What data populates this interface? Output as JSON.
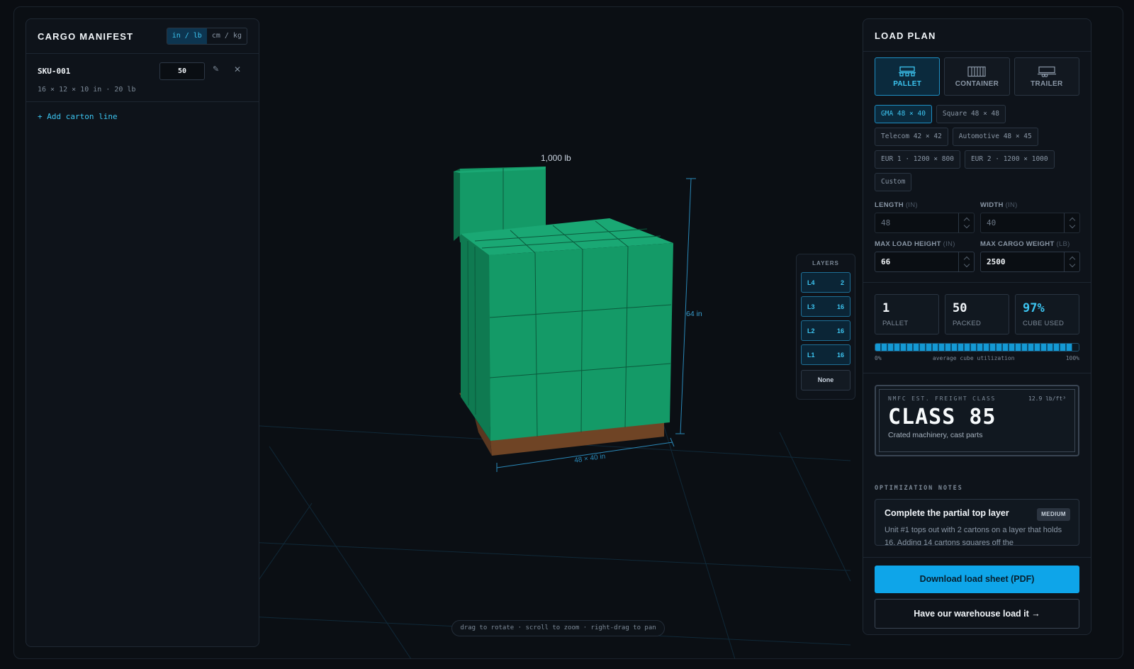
{
  "manifest": {
    "title": "CARGO MANIFEST",
    "units": [
      "in / lb",
      "cm / kg"
    ],
    "active_unit": "in / lb",
    "items": [
      {
        "sku": "SKU-001",
        "qty": "50",
        "dims": "16 × 12 × 10 in · 20 lb"
      }
    ],
    "add_line_label": "+ Add carton line"
  },
  "scene": {
    "weight_label": "1,000 lb",
    "height_label": "64 in",
    "footprint_label": "48 × 40 in",
    "carton_color": "#149a67",
    "pallet_color": "#7a4a26",
    "hint": "drag to rotate · scroll to zoom · right-drag to pan"
  },
  "layers": {
    "title": "LAYERS",
    "items": [
      {
        "id": "L4",
        "count": "2"
      },
      {
        "id": "L3",
        "count": "16"
      },
      {
        "id": "L2",
        "count": "16"
      },
      {
        "id": "L1",
        "count": "16"
      }
    ],
    "none_label": "None"
  },
  "load_plan": {
    "title": "LOAD PLAN",
    "modes": [
      {
        "label": "PALLET",
        "icon": "pallet-icon",
        "active": true
      },
      {
        "label": "CONTAINER",
        "icon": "container-icon",
        "active": false
      },
      {
        "label": "TRAILER",
        "icon": "trailer-icon",
        "active": false
      }
    ],
    "presets": [
      {
        "label": "GMA 48 × 40",
        "active": true
      },
      {
        "label": "Square 48 × 48",
        "active": false
      },
      {
        "label": "Telecom 42 × 42",
        "active": false
      },
      {
        "label": "Automotive 48 × 45",
        "active": false
      },
      {
        "label": "EUR 1 · 1200 × 800",
        "active": false
      },
      {
        "label": "EUR 2 · 1200 × 1000",
        "active": false
      },
      {
        "label": "Custom",
        "active": false
      }
    ],
    "fields": {
      "length": {
        "label": "LENGTH",
        "unit": "(IN)",
        "value": "48"
      },
      "width": {
        "label": "WIDTH",
        "unit": "(IN)",
        "value": "40"
      },
      "max_height": {
        "label": "MAX LOAD HEIGHT",
        "unit": "(IN)",
        "value": "66"
      },
      "max_weight": {
        "label": "MAX CARGO WEIGHT",
        "unit": "(LB)",
        "value": "2500"
      }
    },
    "stats": [
      {
        "value": "1",
        "label": "PALLET"
      },
      {
        "value": "50",
        "label": "PACKED"
      },
      {
        "value": "97%",
        "label": "CUBE USED"
      }
    ],
    "utilization": {
      "fraction": 0.97,
      "min_label": "0%",
      "caption": "average cube utilization",
      "max_label": "100%"
    },
    "freight_class": {
      "kicker": "NMFC EST. FREIGHT CLASS",
      "density": "12.9 lb/ft³",
      "class_label": "CLASS 85",
      "description": "Crated machinery, cast parts"
    },
    "notes": {
      "title": "OPTIMIZATION NOTES",
      "items": [
        {
          "heading": "Complete the partial top layer",
          "badge": "MEDIUM",
          "body": "Unit #1 tops out with 2 cartons on a layer that holds 16. Adding 14 cartons squares off the"
        }
      ]
    },
    "primary_button": "Download load sheet (PDF)",
    "secondary_button": "Have our warehouse load it →"
  }
}
